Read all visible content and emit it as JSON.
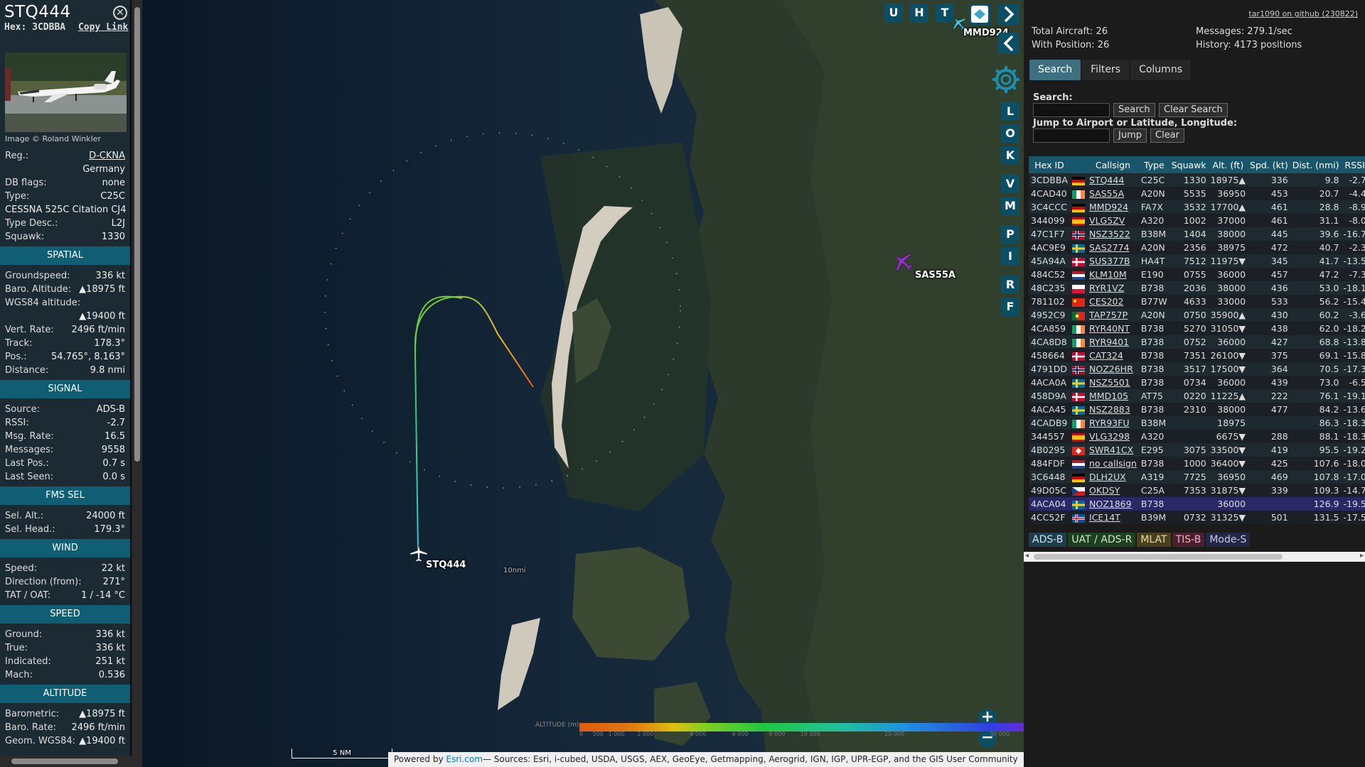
{
  "info": {
    "callsign": "STQ444",
    "hex_label": "Hex:",
    "hex": "3CDBBA",
    "copy_link": "Copy Link",
    "image_credit": "Image © Roland Winkler",
    "rows": [
      {
        "k": "Reg.:",
        "v": "D-CKNA"
      },
      {
        "k": "",
        "v": "Germany"
      },
      {
        "k": "DB flags:",
        "v": "none"
      },
      {
        "k": "Type:",
        "v": "C25C"
      },
      {
        "k": "",
        "v": "CESSNA 525C Citation CJ4"
      },
      {
        "k": "Type Desc.:",
        "v": "L2J"
      },
      {
        "k": "Squawk:",
        "v": "1330"
      }
    ],
    "spatial_title": "SPATIAL",
    "spatial": [
      {
        "k": "Groundspeed:",
        "v": "336 kt"
      },
      {
        "k": "Baro. Altitude:",
        "v": "▲18975 ft"
      },
      {
        "k": "WGS84 altitude:",
        "v": ""
      },
      {
        "k": "",
        "v": "▲19400 ft"
      },
      {
        "k": "Vert. Rate:",
        "v": "2496 ft/min"
      },
      {
        "k": "Track:",
        "v": "178.3°"
      },
      {
        "k": "Pos.:",
        "v": "54.765°, 8.163°"
      },
      {
        "k": "Distance:",
        "v": "9.8 nmi"
      }
    ],
    "signal_title": "SIGNAL",
    "signal": [
      {
        "k": "Source:",
        "v": "ADS-B"
      },
      {
        "k": "RSSI:",
        "v": "-2.7"
      },
      {
        "k": "Msg. Rate:",
        "v": "16.5"
      },
      {
        "k": "Messages:",
        "v": "9558"
      },
      {
        "k": "Last Pos.:",
        "v": "0.7 s"
      },
      {
        "k": "Last Seen:",
        "v": "0.0 s"
      }
    ],
    "fms_title": "FMS SEL",
    "fms": [
      {
        "k": "Sel. Alt.:",
        "v": "24000 ft"
      },
      {
        "k": "Sel. Head.:",
        "v": "179.3°"
      }
    ],
    "wind_title": "WIND",
    "wind": [
      {
        "k": "Speed:",
        "v": "22 kt"
      },
      {
        "k": "Direction (from):",
        "v": "271°"
      },
      {
        "k": "TAT / OAT:",
        "v": "1 / -14 °C"
      }
    ],
    "speed_title": "SPEED",
    "speed": [
      {
        "k": "Ground:",
        "v": "336 kt"
      },
      {
        "k": "True:",
        "v": "336 kt"
      },
      {
        "k": "Indicated:",
        "v": "251 kt"
      },
      {
        "k": "Mach:",
        "v": "0.536"
      }
    ],
    "altitude_title": "ALTITUDE",
    "altitude": [
      {
        "k": "Barometric:",
        "v": "▲18975 ft"
      },
      {
        "k": "Baro. Rate:",
        "v": "2496 ft/min"
      },
      {
        "k": "Geom. WGS84:",
        "v": "▲19400 ft"
      }
    ]
  },
  "map": {
    "labels": {
      "stq": "STQ444",
      "sas": "SAS55A",
      "mmd": "MMD924",
      "ring": "10nmi"
    },
    "top_buttons": [
      "U",
      "H",
      "T"
    ],
    "side_buttons": [
      "L",
      "O",
      "K",
      "V",
      "M",
      "P",
      "I",
      "R",
      "F"
    ],
    "zoom_in": "+",
    "zoom_out": "−",
    "scale": "5 NM",
    "altitude_label": "ALTITUDE (m)",
    "altitude_ticks": [
      "0",
      "500",
      "1 000",
      "2 000",
      "4 000",
      "6 000",
      "8 000",
      "10 000",
      "20 000",
      "30 000",
      "40 000+"
    ],
    "attrib_prefix": "Powered by ",
    "attrib_esri": "Esri.com",
    "attrib_rest": "— Sources: Esri, i-cubed, USDA, USGS, AEX, GeoEye, Getmapping, Aerogrid, IGN, IGP, UPR-EGP, and the GIS User Community"
  },
  "sidebar": {
    "github": "tar1090 on github (230822)",
    "total_aircraft": "Total Aircraft: 26",
    "with_position": "With Position: 26",
    "messages": "Messages: 279.1/sec",
    "history": "History: 4173 positions",
    "tabs": [
      "Search",
      "Filters",
      "Columns"
    ],
    "search_label": "Search:",
    "search_button": "Search",
    "clear_search_button": "Clear Search",
    "jump_label": "Jump to Airport or Latitude, Longitude:",
    "jump_button": "Jump",
    "clear_button": "Clear",
    "columns": [
      "Hex ID",
      "",
      "Callsign",
      "Type",
      "Squawk",
      "Alt. (ft)",
      "Spd. (kt)",
      "Dist. (nmi)",
      "RSSI"
    ],
    "rows": [
      {
        "hex": "3CDBBA",
        "flag": "de",
        "cs": "STQ444",
        "type": "C25C",
        "sq": "1330",
        "alt": "18975▲",
        "spd": "336",
        "dist": "9.8",
        "rssi": "-2.7"
      },
      {
        "hex": "4CAD40",
        "flag": "ie",
        "cs": "SAS55A",
        "type": "A20N",
        "sq": "5535",
        "alt": "36950",
        "spd": "453",
        "dist": "20.7",
        "rssi": "-4.4"
      },
      {
        "hex": "3C4CCC",
        "flag": "de",
        "cs": "MMD924",
        "type": "FA7X",
        "sq": "3532",
        "alt": "17700▲",
        "spd": "461",
        "dist": "28.8",
        "rssi": "-8.9"
      },
      {
        "hex": "344099",
        "flag": "es",
        "cs": "VLG5ZV",
        "type": "A320",
        "sq": "1002",
        "alt": "37000",
        "spd": "461",
        "dist": "31.1",
        "rssi": "-8.0"
      },
      {
        "hex": "47C1F7",
        "flag": "no",
        "cs": "NSZ3522",
        "type": "B38M",
        "sq": "1404",
        "alt": "38000",
        "spd": "445",
        "dist": "39.6",
        "rssi": "-16.7"
      },
      {
        "hex": "4AC9E9",
        "flag": "se",
        "cs": "SAS2774",
        "type": "A20N",
        "sq": "2356",
        "alt": "38975",
        "spd": "472",
        "dist": "40.7",
        "rssi": "-2.3"
      },
      {
        "hex": "45A94A",
        "flag": "dk",
        "cs": "SUS377B",
        "type": "HA4T",
        "sq": "7512",
        "alt": "11975▼",
        "spd": "345",
        "dist": "41.7",
        "rssi": "-13.5"
      },
      {
        "hex": "484C52",
        "flag": "nl",
        "cs": "KLM10M",
        "type": "E190",
        "sq": "0755",
        "alt": "36000",
        "spd": "457",
        "dist": "47.2",
        "rssi": "-7.3"
      },
      {
        "hex": "48C235",
        "flag": "pl",
        "cs": "RYR1VZ",
        "type": "B738",
        "sq": "2036",
        "alt": "38000",
        "spd": "436",
        "dist": "53.0",
        "rssi": "-18.1"
      },
      {
        "hex": "781102",
        "flag": "cn",
        "cs": "CES202",
        "type": "B77W",
        "sq": "4633",
        "alt": "33000",
        "spd": "533",
        "dist": "56.2",
        "rssi": "-15.4"
      },
      {
        "hex": "4952C9",
        "flag": "pt",
        "cs": "TAP757P",
        "type": "A20N",
        "sq": "0750",
        "alt": "35900▲",
        "spd": "430",
        "dist": "60.2",
        "rssi": "-3.6"
      },
      {
        "hex": "4CA859",
        "flag": "ie",
        "cs": "RYR40NT",
        "type": "B738",
        "sq": "5270",
        "alt": "31050▼",
        "spd": "438",
        "dist": "62.0",
        "rssi": "-18.2"
      },
      {
        "hex": "4CA8D8",
        "flag": "ie",
        "cs": "RYR9401",
        "type": "B738",
        "sq": "0752",
        "alt": "36000",
        "spd": "427",
        "dist": "68.8",
        "rssi": "-13.8"
      },
      {
        "hex": "458664",
        "flag": "dk",
        "cs": "CAT324",
        "type": "B738",
        "sq": "7351",
        "alt": "26100▼",
        "spd": "375",
        "dist": "69.1",
        "rssi": "-15.8"
      },
      {
        "hex": "4791DD",
        "flag": "no",
        "cs": "NOZ26HR",
        "type": "B738",
        "sq": "3517",
        "alt": "17500▼",
        "spd": "364",
        "dist": "70.5",
        "rssi": "-17.3"
      },
      {
        "hex": "4ACA0A",
        "flag": "se",
        "cs": "NSZ5501",
        "type": "B738",
        "sq": "0734",
        "alt": "36000",
        "spd": "439",
        "dist": "73.0",
        "rssi": "-6.5"
      },
      {
        "hex": "458D9A",
        "flag": "dk",
        "cs": "MMD105",
        "type": "AT75",
        "sq": "0220",
        "alt": "11225▲",
        "spd": "222",
        "dist": "76.1",
        "rssi": "-19.1"
      },
      {
        "hex": "4ACA45",
        "flag": "se",
        "cs": "NSZ2883",
        "type": "B738",
        "sq": "2310",
        "alt": "38000",
        "spd": "477",
        "dist": "84.2",
        "rssi": "-13.6"
      },
      {
        "hex": "4CADB9",
        "flag": "ie",
        "cs": "RYR93FU",
        "type": "B38M",
        "sq": "",
        "alt": "18975",
        "spd": "",
        "dist": "86.3",
        "rssi": "-18.3"
      },
      {
        "hex": "344557",
        "flag": "es",
        "cs": "VLG3298",
        "type": "A320",
        "sq": "",
        "alt": "6675▼",
        "spd": "288",
        "dist": "88.1",
        "rssi": "-18.3"
      },
      {
        "hex": "4B0295",
        "flag": "ch",
        "cs": "SWR41CX",
        "type": "E295",
        "sq": "3075",
        "alt": "33500▼",
        "spd": "419",
        "dist": "95.5",
        "rssi": "-19.2"
      },
      {
        "hex": "484FDF",
        "flag": "nl",
        "cs": "no callsign",
        "type": "B738",
        "sq": "1000",
        "alt": "36400▼",
        "spd": "425",
        "dist": "107.6",
        "rssi": "-18.0"
      },
      {
        "hex": "3C6448",
        "flag": "de",
        "cs": "DLH2UX",
        "type": "A319",
        "sq": "7725",
        "alt": "36950",
        "spd": "469",
        "dist": "107.8",
        "rssi": "-17.0"
      },
      {
        "hex": "49D05C",
        "flag": "cz",
        "cs": "OKDSY",
        "type": "C25A",
        "sq": "7353",
        "alt": "31875▼",
        "spd": "339",
        "dist": "109.3",
        "rssi": "-14.7"
      },
      {
        "hex": "4ACA04",
        "flag": "se",
        "cs": "NOZ1869",
        "type": "B738",
        "sq": "",
        "alt": "36000",
        "spd": "",
        "dist": "126.9",
        "rssi": "-19.5"
      },
      {
        "hex": "4CC52F",
        "flag": "is",
        "cs": "ICE14T",
        "type": "B39M",
        "sq": "0732",
        "alt": "31325▼",
        "spd": "501",
        "dist": "131.5",
        "rssi": "-17.5"
      }
    ],
    "legend": [
      {
        "label": "ADS-B",
        "bg": "#1e3d4d",
        "fg": "#cfe3ee"
      },
      {
        "label": "UAT / ADS-R",
        "bg": "#1e4020",
        "fg": "#cfe6c8"
      },
      {
        "label": "MLAT",
        "bg": "#4a4020",
        "fg": "#e8d9a8"
      },
      {
        "label": "TIS-B",
        "bg": "#4a2030",
        "fg": "#f0b0c0"
      },
      {
        "label": "Mode-S",
        "bg": "#252545",
        "fg": "#c8c8ee"
      }
    ]
  }
}
